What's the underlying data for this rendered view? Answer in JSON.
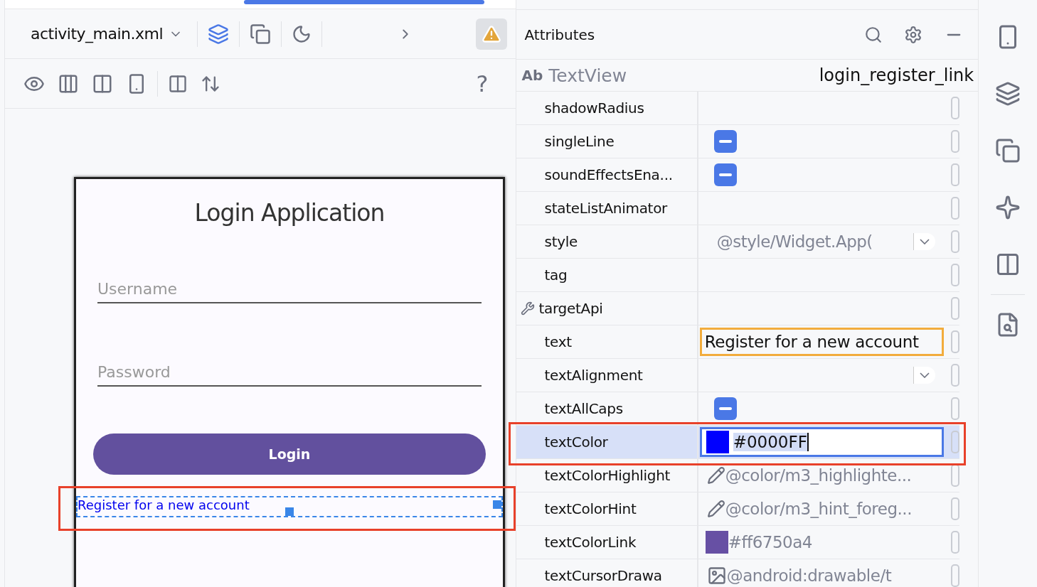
{
  "design_toolbar": {
    "file": "activity_main.xml",
    "help": "?"
  },
  "preview": {
    "title": "Login Application",
    "username_placeholder": "Username",
    "password_placeholder": "Password",
    "login_button": "Login",
    "register_link": "Register for a new account",
    "register_selected": true
  },
  "attributes": {
    "title": "Attributes",
    "component_icon": "Ab",
    "component_type": "TextView",
    "component_id": "login_register_link",
    "rows": [
      {
        "name": "shadowRadius",
        "kind": "empty",
        "selected": false
      },
      {
        "name": "singleLine",
        "kind": "tristate",
        "selected": false
      },
      {
        "name": "soundEffectsEna...",
        "kind": "tristate",
        "selected": false
      },
      {
        "name": "stateListAnimator",
        "kind": "empty",
        "selected": false
      },
      {
        "name": "style",
        "kind": "dropdown",
        "value": "@style/Widget.App(",
        "selected": false
      },
      {
        "name": "tag",
        "kind": "empty",
        "selected": false
      },
      {
        "name": "targetApi",
        "kind": "empty",
        "tool_icon": true,
        "selected": false
      },
      {
        "name": "text",
        "kind": "text",
        "value": "Register for a new account",
        "selected": false
      },
      {
        "name": "textAlignment",
        "kind": "dropdown",
        "selected": false
      },
      {
        "name": "textAllCaps",
        "kind": "tristate",
        "selected": false
      },
      {
        "name": "textColor",
        "kind": "color_edit",
        "value": "#0000FF",
        "color": "#0000ff",
        "selected": true
      },
      {
        "name": "textColorHighlight",
        "kind": "resource",
        "value": "@color/m3_highlighte...",
        "selected": false
      },
      {
        "name": "textColorHint",
        "kind": "resource",
        "value": "@color/m3_hint_foreg...",
        "selected": false
      },
      {
        "name": "textColorLink",
        "kind": "color",
        "value": "#ff6750a4",
        "color": "#6750a4",
        "selected": false
      },
      {
        "name": "textCursorDrawa",
        "kind": "drawable",
        "value": "@android:drawable/t",
        "selected": false
      }
    ]
  }
}
